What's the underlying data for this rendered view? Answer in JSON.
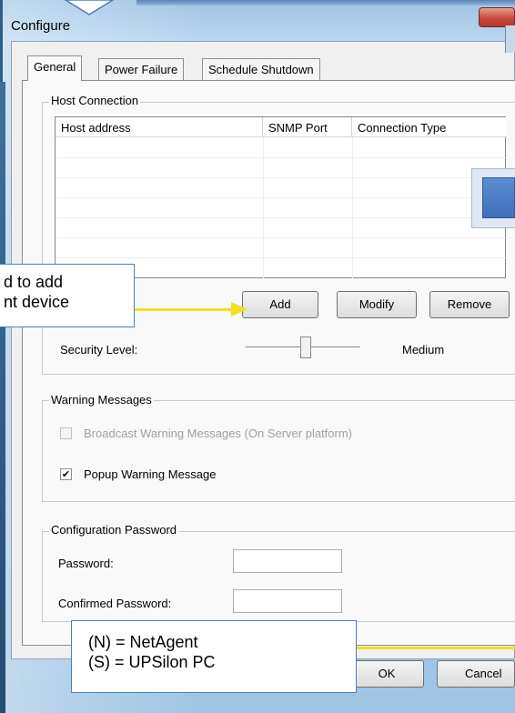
{
  "window": {
    "title": "Configure"
  },
  "tabs": [
    {
      "label": "General",
      "active": true
    },
    {
      "label": "Power Failure",
      "active": false
    },
    {
      "label": "Schedule Shutdown",
      "active": false
    }
  ],
  "host_connection": {
    "group_title": "Host Connection",
    "columns": [
      "Host address",
      "SNMP Port",
      "Connection Type"
    ],
    "rows": []
  },
  "buttons": {
    "add": "Add",
    "modify": "Modify",
    "remove": "Remove",
    "ok": "OK",
    "cancel": "Cancel"
  },
  "security": {
    "label": "Security Level:",
    "value_text": "Medium",
    "level_fraction": 0.5
  },
  "warning_messages": {
    "group_title": "Warning Messages",
    "broadcast": {
      "label": "Broadcast Warning Messages (On Server platform)",
      "checked": false,
      "enabled": false
    },
    "popup": {
      "label": "Popup Warning Message",
      "checked": true,
      "enabled": true
    }
  },
  "configuration_password": {
    "group_title": "Configuration Password",
    "password_label": "Password:",
    "password_value": "",
    "confirm_label": "Confirmed Password:",
    "confirm_value": ""
  },
  "callouts": {
    "add_note_line1": "d to add",
    "add_note_line2": "nt device",
    "legend_line1": "(N) = NetAgent",
    "legend_line2": "(S) = UPSilon PC"
  },
  "colors": {
    "accent_arrow": "#f2e021",
    "callout_border": "#4a7ebb"
  }
}
